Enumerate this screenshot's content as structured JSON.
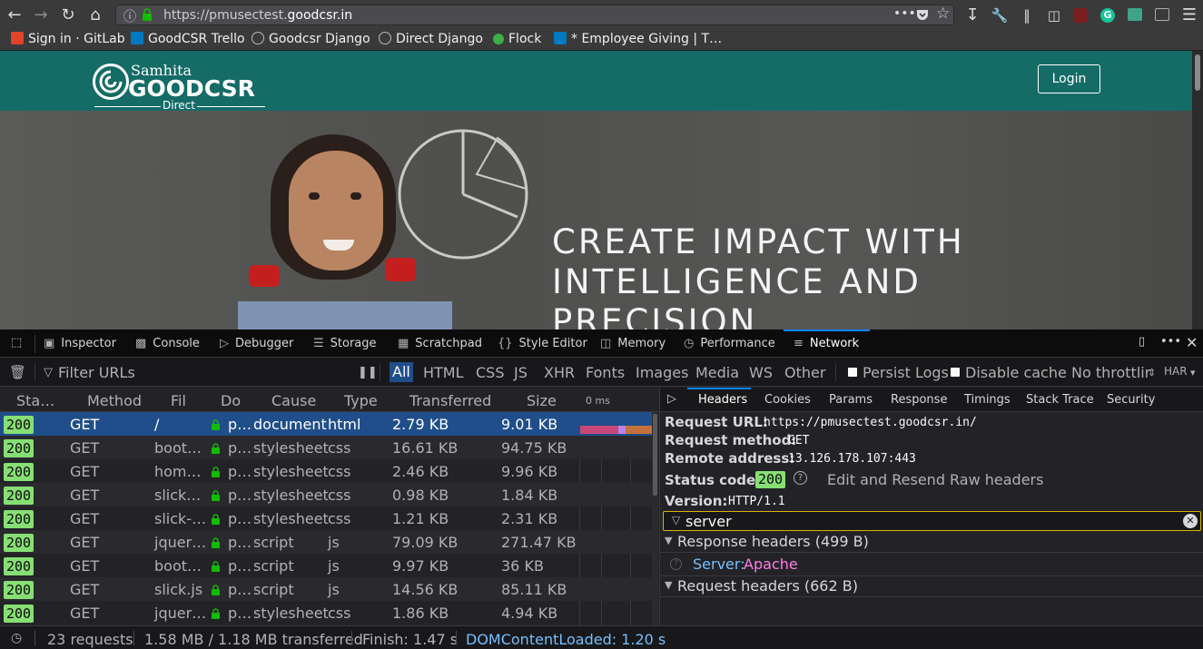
{
  "browser": {
    "url_host_prefix": "https://pmusectest.",
    "url_host_domain": "goodcsr.in",
    "bookmarks": [
      {
        "label": "Sign in · GitLab",
        "icon": "gitlab-icon",
        "color": "#e24329"
      },
      {
        "label": "GoodCSR Trello",
        "icon": "trello-icon",
        "color": "#0079bf"
      },
      {
        "label": "Goodcsr Django",
        "icon": "globe-icon",
        "color": "#9a9a9a"
      },
      {
        "label": "Direct Django",
        "icon": "globe-icon",
        "color": "#9a9a9a"
      },
      {
        "label": "Flock",
        "icon": "flock-icon",
        "color": "#3cb043"
      },
      {
        "label": "* Employee Giving | T…",
        "icon": "trello-icon",
        "color": "#0079bf"
      }
    ]
  },
  "site": {
    "logo_top": "Samhita",
    "logo_main": "GOODCSR",
    "logo_sub": "Direct",
    "login_label": "Login",
    "hero_line1": "CREATE IMPACT WITH",
    "hero_line2": "INTELLIGENCE AND",
    "hero_line3": "PRECISION"
  },
  "devtools": {
    "tabs": [
      "Inspector",
      "Console",
      "Debugger",
      "Storage",
      "Scratchpad",
      "Style Editor",
      "Memory",
      "Performance",
      "Network"
    ],
    "active_tab": "Network",
    "filter_placeholder": "Filter URLs",
    "type_filters": [
      "All",
      "HTML",
      "CSS",
      "JS",
      "XHR",
      "Fonts",
      "Images",
      "Media",
      "WS",
      "Other"
    ],
    "persist_logs": "Persist Logs",
    "disable_cache": "Disable cache",
    "throttling": "No throttlir",
    "har": "HAR",
    "columns": [
      "Sta…",
      "Method",
      "Fil",
      "Do",
      "Cause",
      "Type",
      "Transferred",
      "Size",
      "0 ms"
    ],
    "requests": [
      {
        "status": "200",
        "method": "GET",
        "file": "/",
        "domain": "p…",
        "cause": "document",
        "type": "html",
        "transferred": "2.79 KB",
        "size": "9.01 KB"
      },
      {
        "status": "200",
        "method": "GET",
        "file": "boot…",
        "domain": "p…",
        "cause": "stylesheet",
        "type": "css",
        "transferred": "16.61 KB",
        "size": "94.75 KB"
      },
      {
        "status": "200",
        "method": "GET",
        "file": "hom…",
        "domain": "p…",
        "cause": "stylesheet",
        "type": "css",
        "transferred": "2.46 KB",
        "size": "9.96 KB"
      },
      {
        "status": "200",
        "method": "GET",
        "file": "slick…",
        "domain": "p…",
        "cause": "stylesheet",
        "type": "css",
        "transferred": "0.98 KB",
        "size": "1.84 KB"
      },
      {
        "status": "200",
        "method": "GET",
        "file": "slick-…",
        "domain": "p…",
        "cause": "stylesheet",
        "type": "css",
        "transferred": "1.21 KB",
        "size": "2.31 KB"
      },
      {
        "status": "200",
        "method": "GET",
        "file": "jquer…",
        "domain": "p…",
        "cause": "script",
        "type": "js",
        "transferred": "79.09 KB",
        "size": "271.47 KB"
      },
      {
        "status": "200",
        "method": "GET",
        "file": "boot…",
        "domain": "p…",
        "cause": "script",
        "type": "js",
        "transferred": "9.97 KB",
        "size": "36 KB"
      },
      {
        "status": "200",
        "method": "GET",
        "file": "slick.js",
        "domain": "p…",
        "cause": "script",
        "type": "js",
        "transferred": "14.56 KB",
        "size": "85.11 KB"
      },
      {
        "status": "200",
        "method": "GET",
        "file": "jquer…",
        "domain": "p…",
        "cause": "stylesheet",
        "type": "css",
        "transferred": "1.86 KB",
        "size": "4.94 KB"
      }
    ],
    "detail_tabs": [
      "Headers",
      "Cookies",
      "Params",
      "Response",
      "Timings",
      "Stack Trace",
      "Security"
    ],
    "active_detail_tab": "Headers",
    "request_url_label": "Request URL:",
    "request_url": "https://pmusectest.goodcsr.in/",
    "request_method_label": "Request method:",
    "request_method": "GET",
    "remote_address_label": "Remote address:",
    "remote_address": "13.126.178.107:443",
    "status_code_label": "Status code:",
    "status_code": "200",
    "edit_resend": "Edit and Resend",
    "raw_headers": "Raw headers",
    "version_label": "Version:",
    "version": "HTTP/1.1",
    "header_filter_value": "server",
    "response_headers": "Response headers (499 B)",
    "server_key": "Server:",
    "server_value": "Apache",
    "request_headers": "Request headers (662 B)",
    "summary_requests": "23 requests",
    "summary_transferred": "1.58 MB / 1.18 MB transferred",
    "summary_finish": "Finish: 1.47 s",
    "summary_dcl": "DOMContentLoaded: 1.20 s"
  }
}
